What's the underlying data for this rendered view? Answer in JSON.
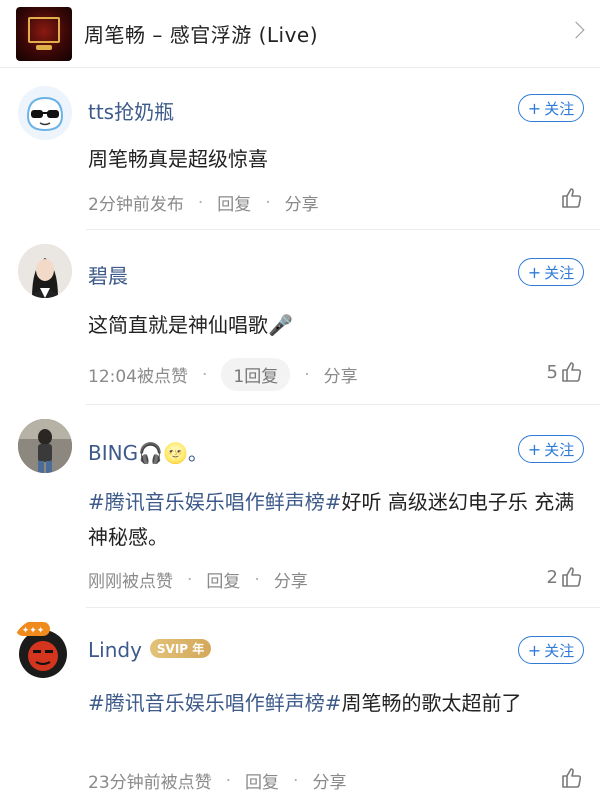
{
  "header": {
    "song_title": "周笔畅 – 感官浮游 (Live)",
    "cover_icon": "album-cover",
    "chevron_icon": "chevron-right-icon"
  },
  "follow_label": "关注",
  "reply_label": "回复",
  "share_label": "分享",
  "comments": [
    {
      "username": "tts抢奶瓶",
      "text": "周笔畅真是超级惊喜",
      "time": "2分钟前发布",
      "reply": "回复",
      "likes": ""
    },
    {
      "username": "碧晨",
      "text": "这简直就是神仙唱歌🎤",
      "time": "12:04被点赞",
      "reply": "1回复",
      "likes": "5"
    },
    {
      "username": "BING🎧🌝。",
      "tag": "#腾讯音乐娱乐唱作鲜声榜#",
      "text": "好听 高级迷幻电子乐 充满神秘感。",
      "time": "刚刚被点赞",
      "reply": "回复",
      "likes": "2"
    },
    {
      "username": "Lindy",
      "badge": "SVIP 年",
      "tag": "#腾讯音乐娱乐唱作鲜声榜#",
      "text": "周笔畅的歌太超前了",
      "time": "23分钟前被点赞",
      "reply": "回复",
      "likes": ""
    }
  ],
  "colors": {
    "link": "#3d5a8a",
    "follow": "#2f7bd6",
    "svip": "#d4a85a"
  }
}
